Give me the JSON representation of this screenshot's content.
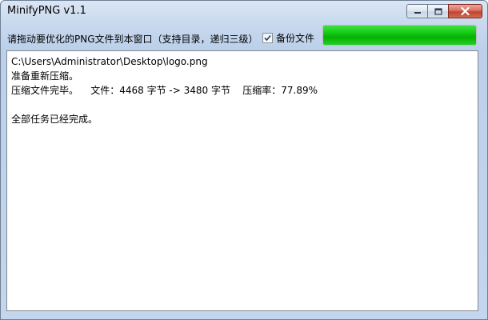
{
  "window": {
    "title": "MinifyPNG v1.1"
  },
  "toolbar": {
    "instruction": "请拖动要优化的PNG文件到本窗口（支持目录，递归三级）",
    "backup_label": "备份文件",
    "backup_checked": true,
    "progress_percent": 100,
    "progress_color": "#12c812"
  },
  "log": {
    "lines": [
      "C:\\Users\\Administrator\\Desktop\\logo.png",
      "准备重新压缩。",
      "压缩文件完毕。    文件：4468 字节 -> 3480 字节    压缩率：77.89%",
      "",
      "全部任务已经完成。"
    ]
  },
  "icons": {
    "minimize": "minimize-icon",
    "maximize": "maximize-icon",
    "close": "close-icon",
    "check": "checkmark-icon"
  }
}
